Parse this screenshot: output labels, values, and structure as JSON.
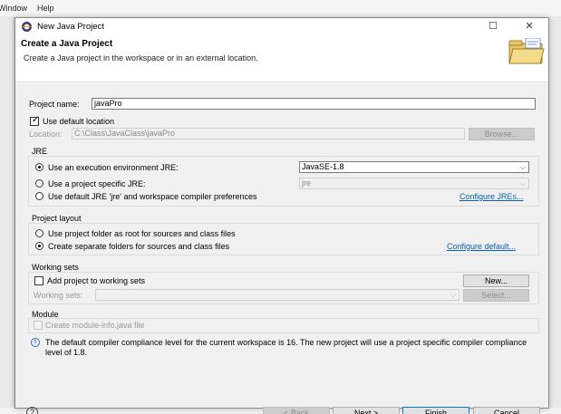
{
  "background_window": {
    "menu_items": [
      "Window",
      "Help"
    ]
  },
  "dialog": {
    "title": "New Java Project",
    "minimize_glyph": "☐",
    "close_glyph": "✕",
    "header": {
      "title": "Create a Java Project",
      "description": "Create a Java project in the workspace or in an external location.",
      "image_icon": "folder-wizard-icon"
    },
    "project_name": {
      "label": "Project name:",
      "value": "javaPro"
    },
    "use_default_location": {
      "label": "Use default location",
      "checked": true
    },
    "location": {
      "label": "Location:",
      "value": "C:\\Class\\JavaClass\\javaPro",
      "browse_label": "Browse..."
    },
    "jre": {
      "group_label": "JRE",
      "option_env": "Use an execution environment JRE:",
      "option_specific": "Use a project specific JRE:",
      "option_default": "Use default JRE 'jre' and workspace compiler preferences",
      "env_value": "JavaSE-1.8",
      "specific_value": "jre",
      "configure_link": "Configure JREs..."
    },
    "project_layout": {
      "group_label": "Project layout",
      "option_root": "Use project folder as root for sources and class files",
      "option_separate": "Create separate folders for sources and class files",
      "configure_link": "Configure default..."
    },
    "working_sets": {
      "group_label": "Working sets",
      "add_label": "Add project to working sets",
      "new_label": "New...",
      "sets_label": "Working sets:",
      "select_label": "Select..."
    },
    "module": {
      "group_label": "Module",
      "create_label": "Create module-info.java file"
    },
    "info_message": "The default compiler compliance level for the current workspace is 16. The new project will use a project specific compiler compliance level of 1.8.",
    "buttons": {
      "help_glyph": "?",
      "back": "< Back",
      "next": "Next >",
      "finish": "Finish",
      "cancel": "Cancel"
    }
  },
  "colors": {
    "link": "#0a5fb4",
    "default_button_border": "#0078d7",
    "dialog_body": "#f0f0f0"
  }
}
